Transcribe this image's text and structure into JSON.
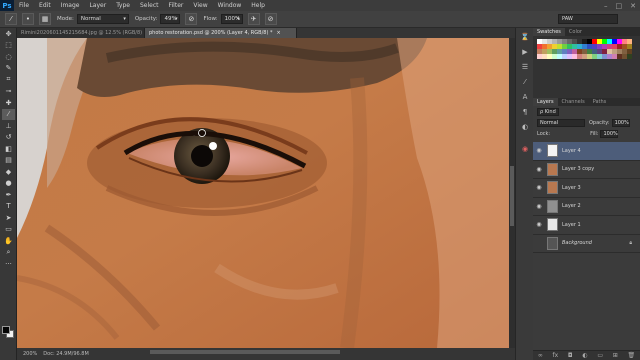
{
  "app": {
    "logo": "Ps"
  },
  "menu": [
    "File",
    "Edit",
    "Image",
    "Layer",
    "Type",
    "Select",
    "Filter",
    "View",
    "Window",
    "Help"
  ],
  "window_controls": [
    "–",
    "□",
    "✕"
  ],
  "options_bar": {
    "mode_label": "Mode:",
    "mode_value": "Normal",
    "opacity_label": "Opacity:",
    "opacity_value": "49%",
    "flow_label": "Flow:",
    "flow_value": "100%",
    "workspace": "PAW"
  },
  "tabs": [
    {
      "label": "Rimini2020601145215684.jpg @ 12.5% (RGB/8)",
      "close": "×",
      "active": false
    },
    {
      "label": "photo restoration.psd @ 200% (Layer 4, RGB/8) *",
      "close": "×",
      "active": true
    }
  ],
  "status": {
    "zoom": "200%",
    "doc": "Doc: 24.9M/96.8M"
  },
  "panels": {
    "swatch_tabs": [
      "Swatches",
      "Color"
    ],
    "layer_tabs": [
      "Layers",
      "Channels",
      "Paths"
    ],
    "kind_label": "ρ Kind",
    "blend_mode": "Normal",
    "opacity_label": "Opacity:",
    "opacity_value": "100%",
    "lock_label": "Lock:",
    "fill_label": "Fill:",
    "fill_value": "100%"
  },
  "layers": [
    {
      "name": "Layer 4",
      "active": true,
      "thumb": "#f4f4f4"
    },
    {
      "name": "Layer 3 copy",
      "active": false,
      "thumb": "#b87850"
    },
    {
      "name": "Layer 3",
      "active": false,
      "thumb": "#b87850"
    },
    {
      "name": "Layer 2",
      "active": false,
      "thumb": "#909090"
    },
    {
      "name": "Layer 1",
      "active": false,
      "thumb": "#e8e8e8"
    },
    {
      "name": "Background",
      "active": false,
      "thumb": "#555555",
      "locked": true
    }
  ],
  "swatch_colors": [
    "#ffffff",
    "#e6e6e6",
    "#cccccc",
    "#b3b3b3",
    "#999999",
    "#808080",
    "#666666",
    "#4d4d4d",
    "#333333",
    "#1a1a1a",
    "#000000",
    "#ff0000",
    "#ffff00",
    "#00ff00",
    "#00ffff",
    "#0000ff",
    "#ff00ff",
    "#ff8080",
    "#ffb380",
    "#f04040",
    "#f07030",
    "#f0a030",
    "#f0d030",
    "#c0e030",
    "#70d040",
    "#30c060",
    "#30c0a0",
    "#30b0d0",
    "#3080d0",
    "#3050c0",
    "#5040c0",
    "#8040c0",
    "#b040b0",
    "#d04080",
    "#e04060",
    "#a02020",
    "#a05020",
    "#a08020",
    "#c08060",
    "#c0a060",
    "#a0c060",
    "#60a060",
    "#60a0a0",
    "#6080c0",
    "#8060c0",
    "#c060a0",
    "#804020",
    "#806040",
    "#408040",
    "#406080",
    "#604080",
    "#802040",
    "#e0c0a0",
    "#c0a080",
    "#a08060",
    "#806040",
    "#604020",
    "#ffd0d0",
    "#ffe0c0",
    "#ffffc0",
    "#d0ffd0",
    "#c0ffff",
    "#c0d0ff",
    "#e0c0ff",
    "#ffc0e0",
    "#d08080",
    "#d0a080",
    "#d0d080",
    "#80d080",
    "#80d0d0",
    "#8090d0",
    "#b080d0",
    "#d080b0",
    "#603020",
    "#705030",
    "#304020"
  ]
}
